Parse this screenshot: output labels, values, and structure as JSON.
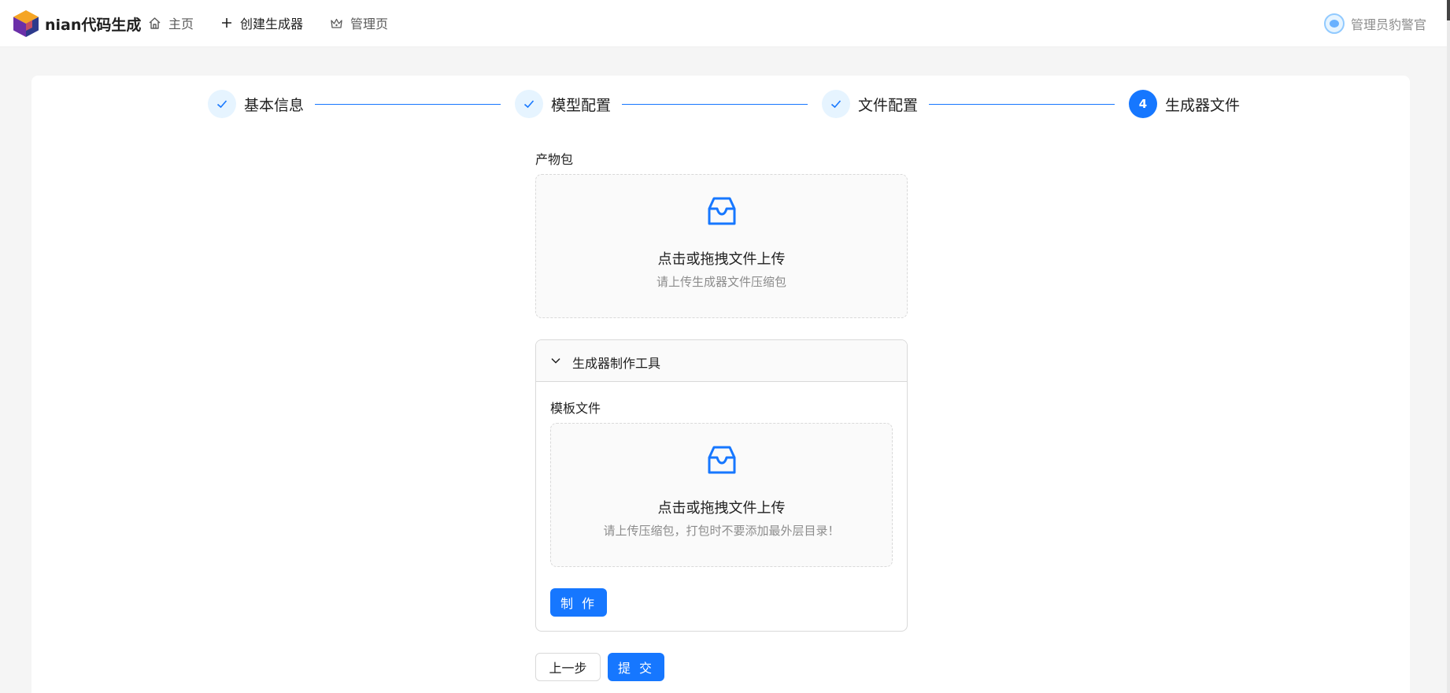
{
  "header": {
    "brand": "nian代码生成",
    "nav": {
      "home": "主页",
      "create": "创建生成器",
      "admin": "管理页"
    },
    "user_name": "管理员豹警官"
  },
  "steps": [
    {
      "label": "基本信息",
      "status": "done"
    },
    {
      "label": "模型配置",
      "status": "done"
    },
    {
      "label": "文件配置",
      "status": "done"
    },
    {
      "label": "生成器文件",
      "status": "active",
      "number": "4"
    }
  ],
  "form": {
    "dist_label": "产物包",
    "dist_upload": {
      "text": "点击或拖拽文件上传",
      "hint": "请上传生成器文件压缩包"
    },
    "collapse": {
      "title": "生成器制作工具",
      "template_label": "模板文件",
      "template_upload": {
        "text": "点击或拖拽文件上传",
        "hint": "请上传压缩包，打包时不要添加最外层目录！"
      },
      "make_button": "制 作"
    },
    "prev_button": "上一步",
    "submit_button": "提 交"
  },
  "colors": {
    "primary": "#1677ff",
    "step_done_bg": "#e6f4ff",
    "dragger_bg": "#fafafa",
    "page_bg": "#f5f5f5"
  }
}
